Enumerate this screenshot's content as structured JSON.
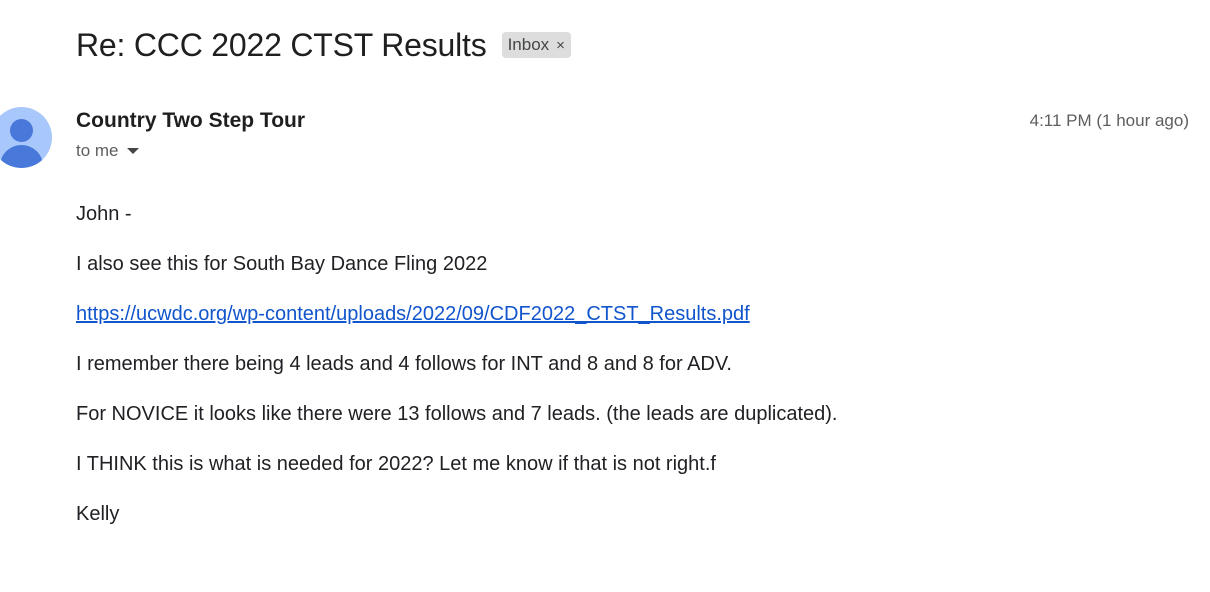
{
  "email": {
    "subject": "Re: CCC 2022 CTST Results",
    "label": "Inbox",
    "label_close": "×",
    "sender": "Country Two Step Tour",
    "recipient": "to me",
    "timestamp": "4:11 PM (1 hour ago)",
    "avatar_icon": "person-icon",
    "avatar_color": "#a8c7fa",
    "link_color": "#1155cc",
    "body": {
      "greeting": "John -",
      "line1": "I also see this for South Bay Dance Fling 2022",
      "link": "https://ucwdc.org/wp-content/uploads/2022/09/CDF2022_CTST_Results.pdf",
      "line2": "I remember there being 4 leads and 4 follows for INT and 8 and 8 for ADV.",
      "line3": "For NOVICE it looks like there were 13 follows and 7 leads. (the leads are duplicated).",
      "line4": "I THINK this is what is needed for 2022? Let me know if that is not right.f",
      "signature": "Kelly"
    }
  }
}
